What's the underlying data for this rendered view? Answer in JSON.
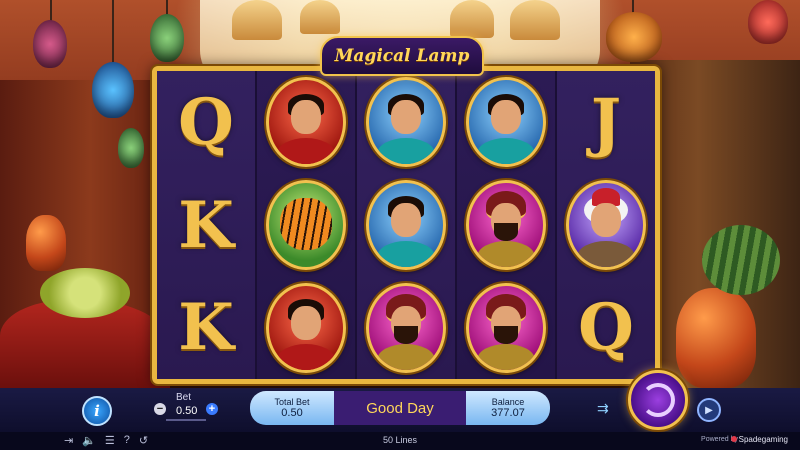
{
  "game": {
    "logo": "Magical Lamp"
  },
  "reels": [
    [
      {
        "type": "letter",
        "value": "Q"
      },
      {
        "type": "letter",
        "value": "K"
      },
      {
        "type": "letter",
        "value": "K"
      }
    ],
    [
      {
        "type": "character",
        "value": "aladdin",
        "color": "red"
      },
      {
        "type": "character",
        "value": "tiger",
        "color": "green"
      },
      {
        "type": "character",
        "value": "aladdin",
        "color": "red"
      }
    ],
    [
      {
        "type": "character",
        "value": "princess",
        "color": "blue"
      },
      {
        "type": "character",
        "value": "princess",
        "color": "blue"
      },
      {
        "type": "character",
        "value": "sultan",
        "color": "pink"
      }
    ],
    [
      {
        "type": "character",
        "value": "princess",
        "color": "blue"
      },
      {
        "type": "character",
        "value": "sultan",
        "color": "pink"
      },
      {
        "type": "character",
        "value": "sultan",
        "color": "pink"
      }
    ],
    [
      {
        "type": "letter",
        "value": "J"
      },
      {
        "type": "character",
        "value": "old-man",
        "color": "purple"
      },
      {
        "type": "letter",
        "value": "Q"
      }
    ]
  ],
  "controls": {
    "info_icon": "info-icon",
    "bet_label": "Bet",
    "bet_value": "0.50",
    "minus": "−",
    "plus": "+",
    "total_bet_label": "Total Bet",
    "total_bet_value": "0.50",
    "message": "Good Day",
    "balance_label": "Balance",
    "balance_value": "377.07",
    "autoplay_icon": "autoplay-icon",
    "spin_icon": "spin-icon",
    "play_icon": "play-icon"
  },
  "footer": {
    "lines": "50 Lines",
    "powered_by": "Powered by",
    "brand": "Spadegaming"
  }
}
